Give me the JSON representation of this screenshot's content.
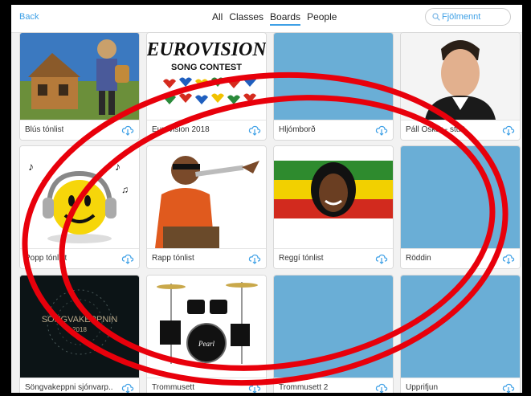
{
  "topbar": {
    "back_label": "Back",
    "tabs": [
      {
        "label": "All"
      },
      {
        "label": "Classes"
      },
      {
        "label": "Boards",
        "active": true
      },
      {
        "label": "People"
      }
    ],
    "search_value": "Fjölmennt",
    "search_placeholder": "Fjölmennt"
  },
  "boards": [
    {
      "title": "Blús tónlist",
      "image": "cartoon-blues-icon"
    },
    {
      "title": "Eurovision 2018",
      "image": "eurovision-logo-icon",
      "logo_text": "EUROVISION",
      "logo_sub": "SONG CONTEST"
    },
    {
      "title": "Hljómborð",
      "image": "blank"
    },
    {
      "title": "Páll Óskar - stutt",
      "image": "portrait-man-icon"
    },
    {
      "title": "Popp tónlist",
      "image": "smiley-headphones-icon"
    },
    {
      "title": "Rapp tónlist",
      "image": "rapper-cartoon-icon"
    },
    {
      "title": "Reggí tónlist",
      "image": "reggae-portrait-icon"
    },
    {
      "title": "Röddin",
      "image": "blank"
    },
    {
      "title": "Söngvakeppni sjónvarp...",
      "image": "songvakeppni-logo-icon",
      "logo_text": "SÖNGVAKEPPNIN",
      "logo_sub": "2018"
    },
    {
      "title": "Trommusett",
      "image": "drum-kit-icon",
      "logo_text": "Pearl"
    },
    {
      "title": "Trommusett 2",
      "image": "blank"
    },
    {
      "title": "Upprifjun",
      "image": "blank"
    }
  ],
  "colors": {
    "accent": "#3ea0e6",
    "blank_tile": "#6aaed6",
    "annotation": "#e8000b"
  }
}
